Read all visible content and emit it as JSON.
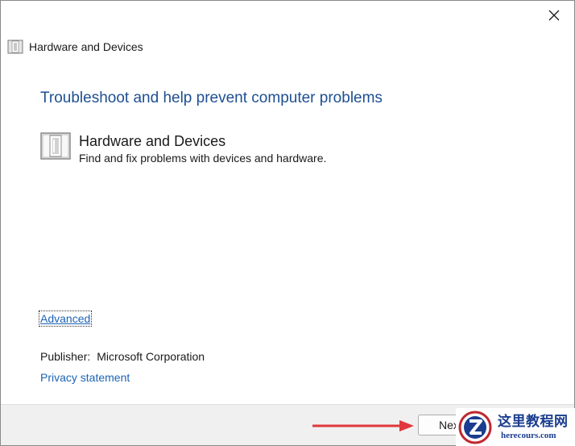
{
  "window": {
    "title": "Hardware and Devices",
    "close_icon": "close-icon"
  },
  "main": {
    "heading": "Troubleshoot and help prevent computer problems",
    "tool": {
      "icon": "hardware-device-icon",
      "name": "Hardware and Devices",
      "description": "Find and fix problems with devices and hardware."
    },
    "advanced_link": "Advanced",
    "publisher_label": "Publisher:",
    "publisher_value": "Microsoft Corporation",
    "privacy_link": "Privacy statement"
  },
  "footer": {
    "next_label": "Next"
  },
  "annotation": {
    "arrow_color": "#e0383c"
  },
  "watermark": {
    "title": "这里教程网",
    "url": "herecours.com",
    "logo": "z-logo"
  },
  "colors": {
    "heading": "#1e4f91",
    "link": "#1c63b4",
    "footer_bg": "#f0f0f0"
  }
}
